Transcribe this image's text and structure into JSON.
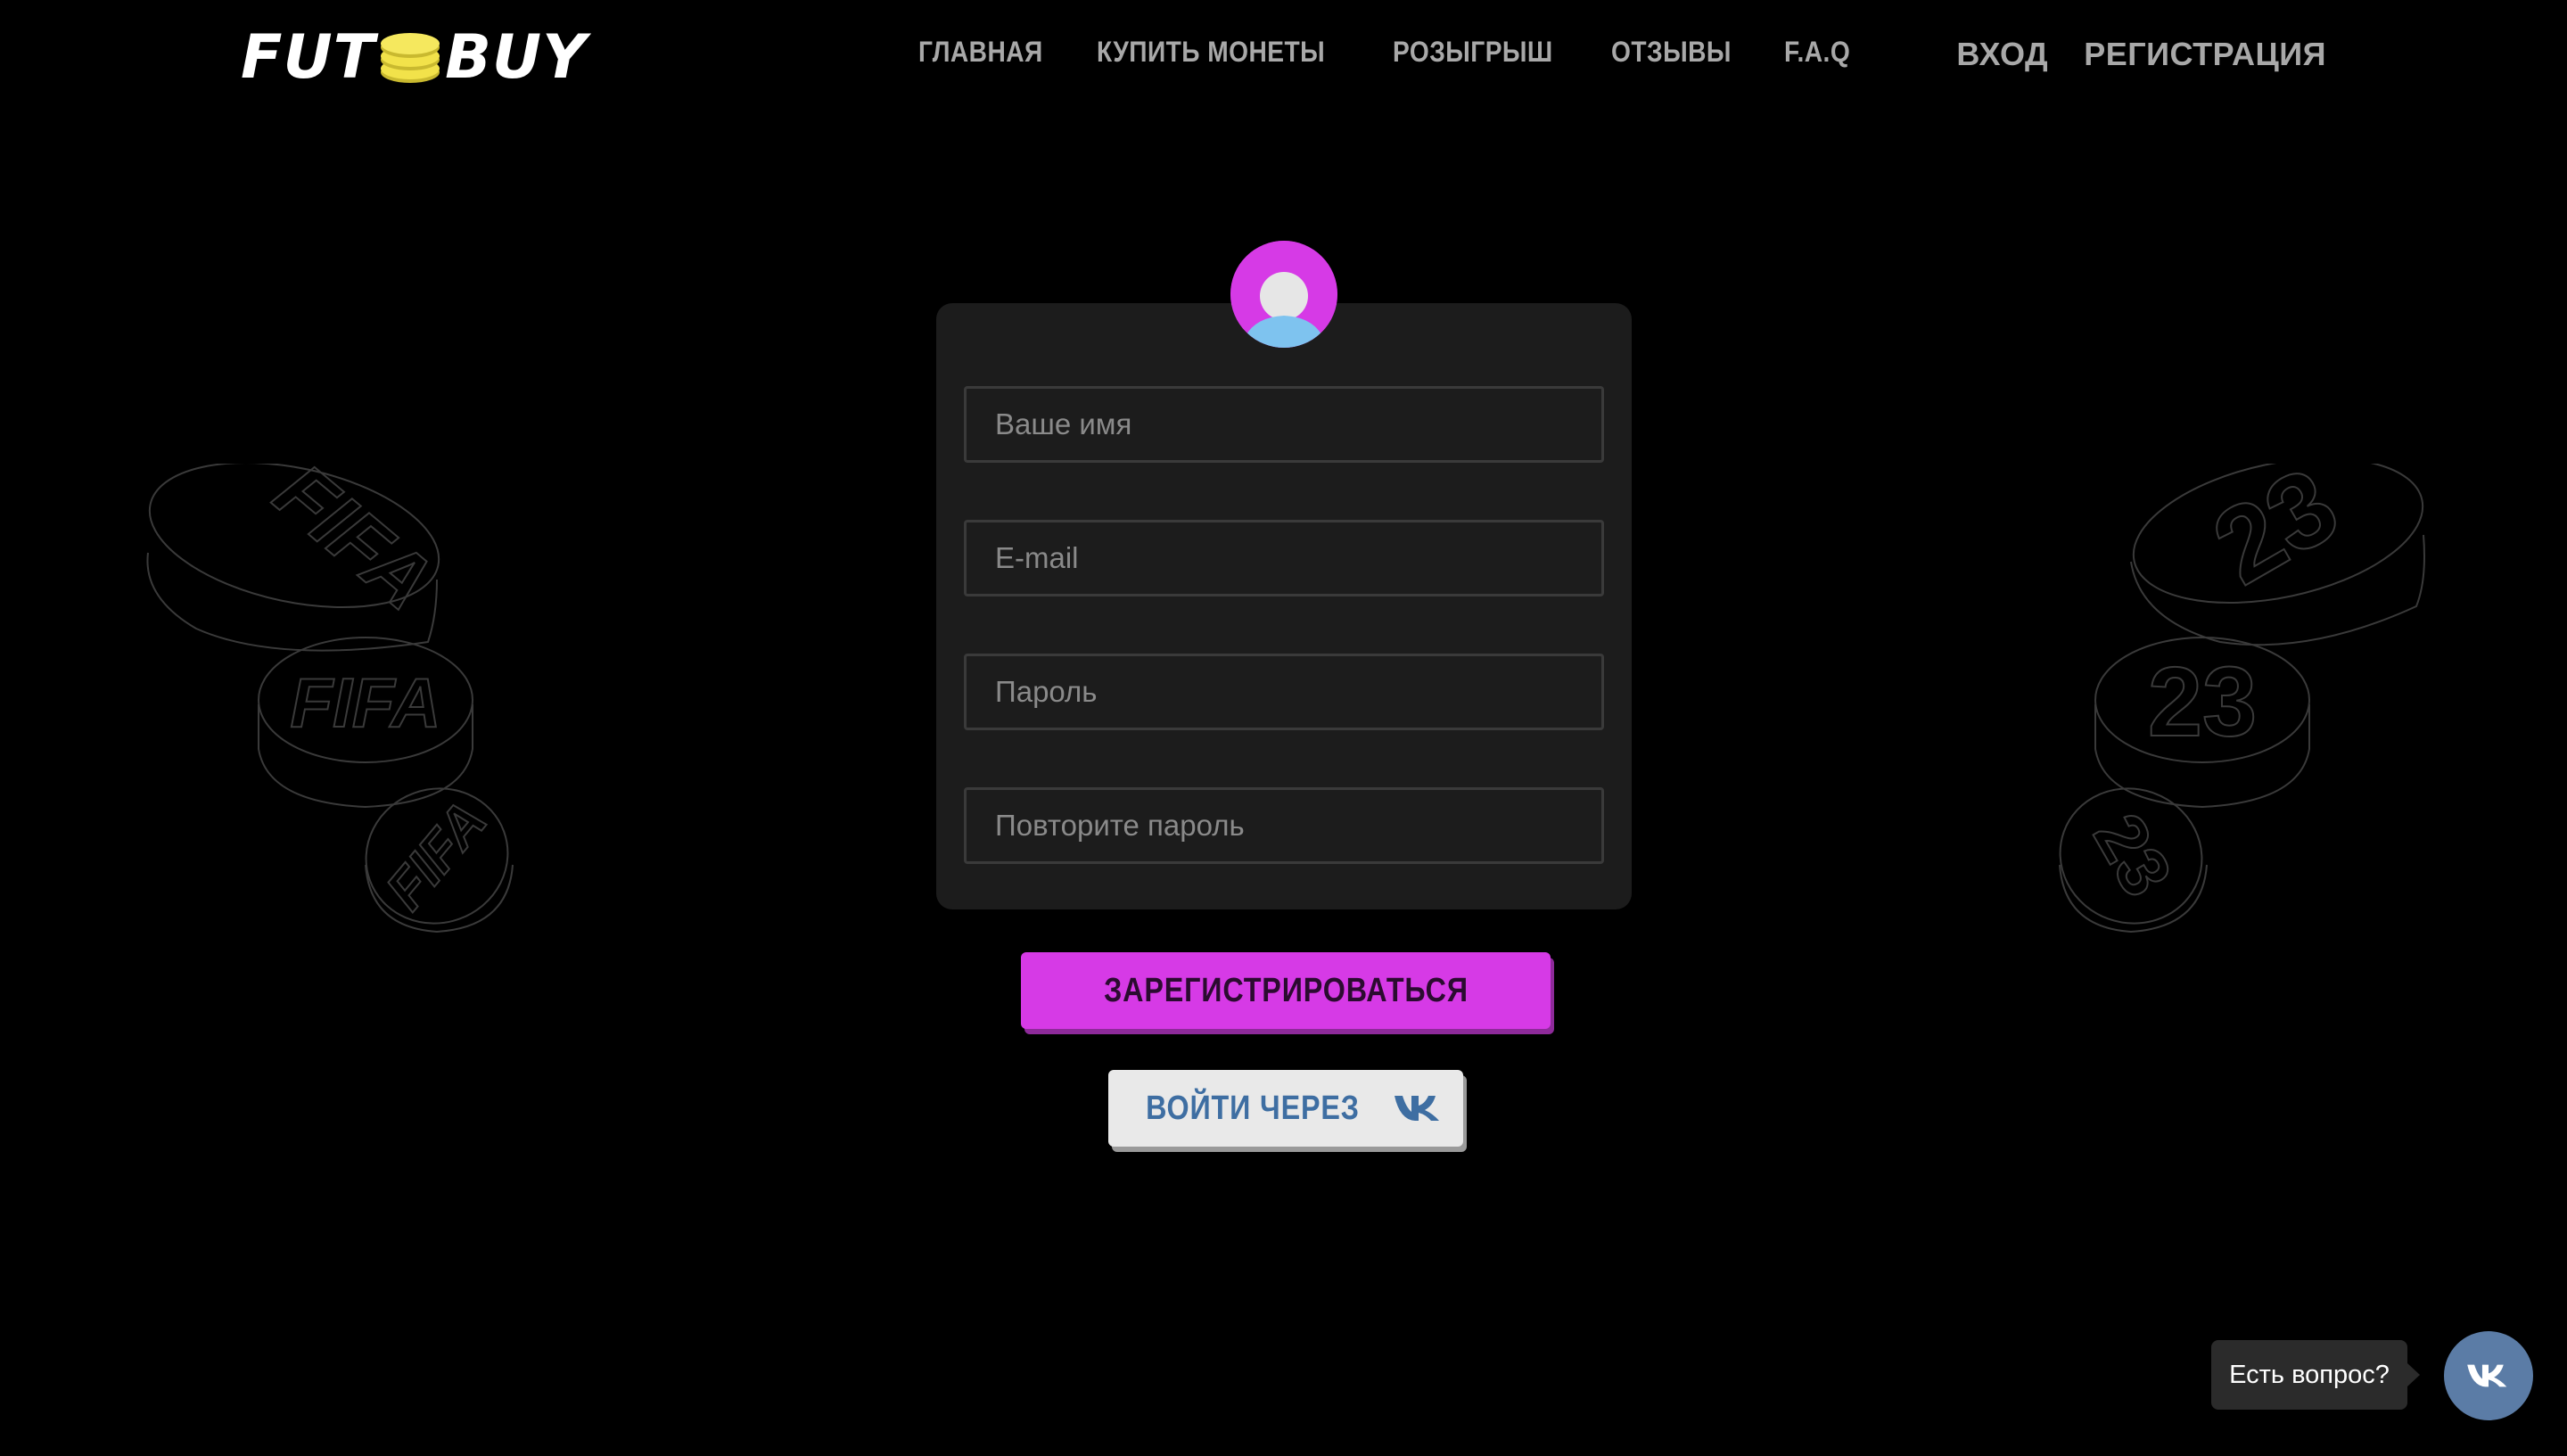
{
  "header": {
    "logo": {
      "left": "FUT",
      "right": "BUY"
    },
    "nav": [
      "ГЛАВНАЯ",
      "КУПИТЬ МОНЕТЫ",
      "РОЗЫГРЫШ",
      "ОТЗЫВЫ",
      "F.A.Q"
    ],
    "auth": {
      "login": "ВХОД",
      "register": "РЕГИСТРАЦИЯ"
    }
  },
  "form": {
    "name_placeholder": "Ваше имя",
    "email_placeholder": "E-mail",
    "password_placeholder": "Пароль",
    "repeat_password_placeholder": "Повторите пароль",
    "submit_label": "ЗАРЕГИСТРИРОВАТЬСЯ",
    "vk_login_label": "ВОЙТИ ЧЕРЕЗ"
  },
  "decorations": {
    "left_coins_text": "FIFA",
    "right_coins_text": "23"
  },
  "chat": {
    "label": "Есть вопрос?"
  },
  "colors": {
    "background": "#000000",
    "accent": "#d63ae6",
    "vk_blue": "#3e6ea2",
    "coin_gold": "#f2e24a"
  },
  "icons": [
    "coin-stack-icon",
    "user-avatar-icon",
    "vk-icon"
  ]
}
